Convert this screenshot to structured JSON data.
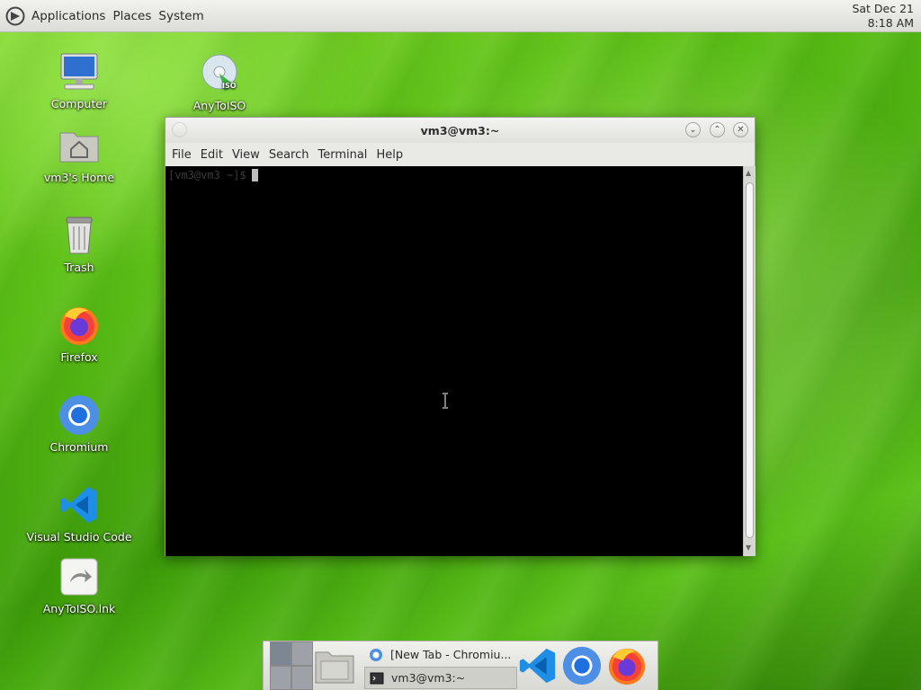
{
  "top_panel": {
    "menus": [
      "Applications",
      "Places",
      "System"
    ],
    "clock": {
      "date": "Sat Dec 21",
      "time": "8:18 AM"
    }
  },
  "desktop": {
    "icons": [
      {
        "label": "Computer",
        "icon": "computer-icon"
      },
      {
        "label": "vm3's Home",
        "icon": "home-folder-icon"
      },
      {
        "label": "Trash",
        "icon": "trash-icon"
      },
      {
        "label": "Firefox",
        "icon": "firefox-icon"
      },
      {
        "label": "Chromium",
        "icon": "chromium-icon"
      },
      {
        "label": "Visual Studio Code",
        "icon": "vscode-icon"
      },
      {
        "label": "AnyToISO.lnk",
        "icon": "shortcut-icon"
      },
      {
        "label": "AnyToISO",
        "icon": "disc-iso-icon"
      }
    ]
  },
  "window": {
    "title": "vm3@vm3:~",
    "menu": [
      "File",
      "Edit",
      "View",
      "Search",
      "Terminal",
      "Help"
    ],
    "prompt": "[vm3@vm3 ~]$"
  },
  "taskbar": {
    "tasks": [
      {
        "label": "[New Tab - Chromiu...",
        "icon": "chromium-icon"
      },
      {
        "label": "vm3@vm3:~",
        "icon": "terminal-icon"
      }
    ],
    "launchers": [
      "vscode-icon",
      "chromium-icon",
      "firefox-icon"
    ]
  },
  "colors": {
    "desktop_green": "#5cc016",
    "panel": "#e4e4e0",
    "terminal_bg": "#000000"
  }
}
